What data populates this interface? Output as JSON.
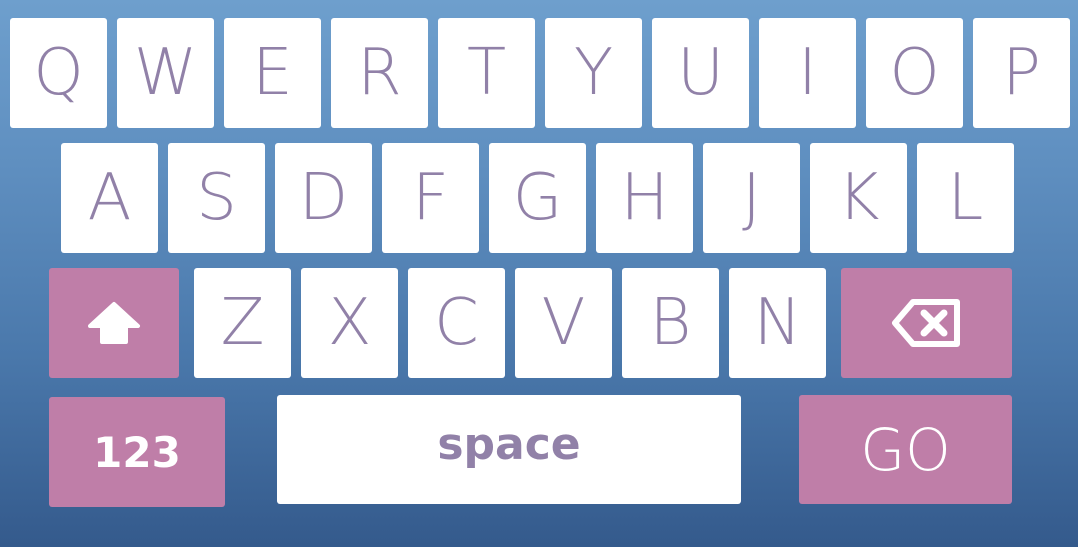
{
  "keyboard": {
    "row1": [
      "Q",
      "W",
      "E",
      "R",
      "T",
      "Y",
      "U",
      "I",
      "O",
      "P"
    ],
    "row2": [
      "A",
      "S",
      "D",
      "F",
      "G",
      "H",
      "J",
      "K",
      "L"
    ],
    "row3": [
      "Z",
      "X",
      "C",
      "V",
      "B",
      "N"
    ],
    "shift_icon": "shift-arrow-icon",
    "backspace_icon": "backspace-icon",
    "numbers_label": "123",
    "space_label": "space",
    "go_label": "GO",
    "colors": {
      "background_top": "#6e9fcd",
      "background_bottom": "#345a8c",
      "key": "#ffffff",
      "key_text": "#9181a8",
      "accent_key": "#bf7ea8",
      "accent_text": "#ffffff"
    }
  }
}
